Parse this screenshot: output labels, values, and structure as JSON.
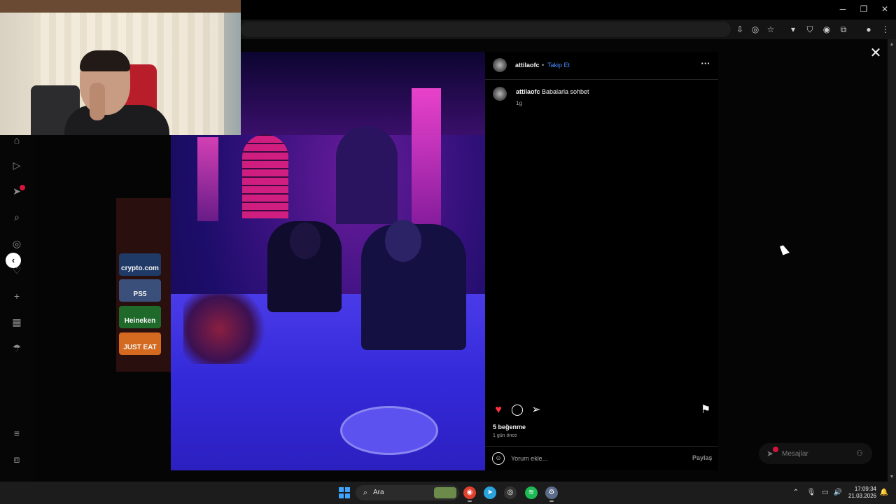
{
  "post": {
    "username": "attilaofc",
    "separator": "•",
    "follow_label": "Takip Et",
    "more_icon": "more-horizontal-icon",
    "caption_user": "attilaofc",
    "caption_text": "Babalarla sohbet",
    "caption_time": "1g",
    "likes": "5 beğenme",
    "time_ago": "1 gün önce",
    "comment_placeholder": "Yorum ekle...",
    "share_label": "Paylaş",
    "liked": true
  },
  "messages": {
    "label": "Mesajlar",
    "badge_color": "#d4143d"
  },
  "sponsors": [
    {
      "name": "crypto.com",
      "color": "#1f3a66"
    },
    {
      "name": "PS5",
      "color": "#3a4f7a"
    },
    {
      "name": "Heineken",
      "color": "#1f6a2b"
    },
    {
      "name": "JUST EAT",
      "color": "#d46a1f"
    }
  ],
  "taskbar": {
    "search_label": "Ara",
    "time": "17:09:34",
    "date": "21.03.2026"
  },
  "colors": {
    "accent_link": "#4a8cff",
    "like": "#ff3040",
    "photo_tint": "#3a29d8"
  }
}
